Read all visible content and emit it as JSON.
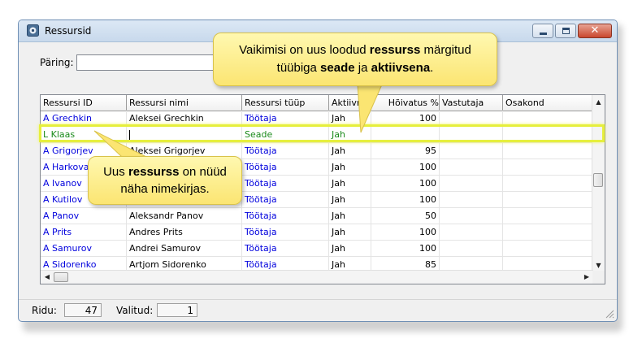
{
  "window": {
    "title": "Ressursid",
    "controls": {
      "minimize": "minimize-icon",
      "maximize": "maximize-icon",
      "close": "close-icon"
    }
  },
  "query": {
    "label": "Päring:",
    "value": ""
  },
  "grid": {
    "columns": [
      "Ressursi ID",
      "Ressursi nimi",
      "Ressursi tüüp",
      "Aktiivne",
      "Hõivatus %",
      "Vastutaja",
      "Osakond"
    ],
    "rows": [
      {
        "id": "A Grechkin",
        "name": "Aleksei Grechkin",
        "type": "Töötaja",
        "active": "Jah",
        "pct": "100",
        "resp": "",
        "dept": ""
      },
      {
        "id": "L Klaas",
        "name": "",
        "type": "Seade",
        "active": "Jah",
        "pct": "",
        "resp": "",
        "dept": ""
      },
      {
        "id": "A Grigorjev",
        "name": "Aleksei Grigorjev",
        "type": "Töötaja",
        "active": "Jah",
        "pct": "95",
        "resp": "",
        "dept": ""
      },
      {
        "id": "A Harkova",
        "name": "",
        "type": "Töötaja",
        "active": "Jah",
        "pct": "100",
        "resp": "",
        "dept": ""
      },
      {
        "id": "A Ivanov",
        "name": "",
        "type": "Töötaja",
        "active": "Jah",
        "pct": "100",
        "resp": "",
        "dept": ""
      },
      {
        "id": "A Kutilov",
        "name": "",
        "type": "Töötaja",
        "active": "Jah",
        "pct": "100",
        "resp": "",
        "dept": ""
      },
      {
        "id": "A Panov",
        "name": "Aleksandr Panov",
        "type": "Töötaja",
        "active": "Jah",
        "pct": "50",
        "resp": "",
        "dept": ""
      },
      {
        "id": "A Prits",
        "name": "Andres Prits",
        "type": "Töötaja",
        "active": "Jah",
        "pct": "100",
        "resp": "",
        "dept": ""
      },
      {
        "id": "A Samurov",
        "name": "Andrei Samurov",
        "type": "Töötaja",
        "active": "Jah",
        "pct": "100",
        "resp": "",
        "dept": ""
      },
      {
        "id": "A Sidorenko",
        "name": "Artjom Sidorenko",
        "type": "Töötaja",
        "active": "Jah",
        "pct": "85",
        "resp": "",
        "dept": ""
      }
    ]
  },
  "status": {
    "rows_label": "Ridu:",
    "rows_value": "47",
    "selected_label": "Valitud:",
    "selected_value": "1"
  },
  "callouts": {
    "top": {
      "t1": "Vaikimisi on uus loodud ",
      "b1": "ressurss",
      "t2": " märgitud",
      "t3": "tüübiga ",
      "b2": "seade",
      "t4": " ja ",
      "b3": "aktiivsena",
      "t5": "."
    },
    "left": {
      "t1": "Uus ",
      "b1": "ressurss",
      "t2": " on nüüd",
      "t3": "näha nimekirjas."
    }
  },
  "colors": {
    "link_blue": "#0000dd",
    "new_green": "#1a8a1a",
    "highlight": "#e6ef3d",
    "callout": "#fbe572"
  }
}
